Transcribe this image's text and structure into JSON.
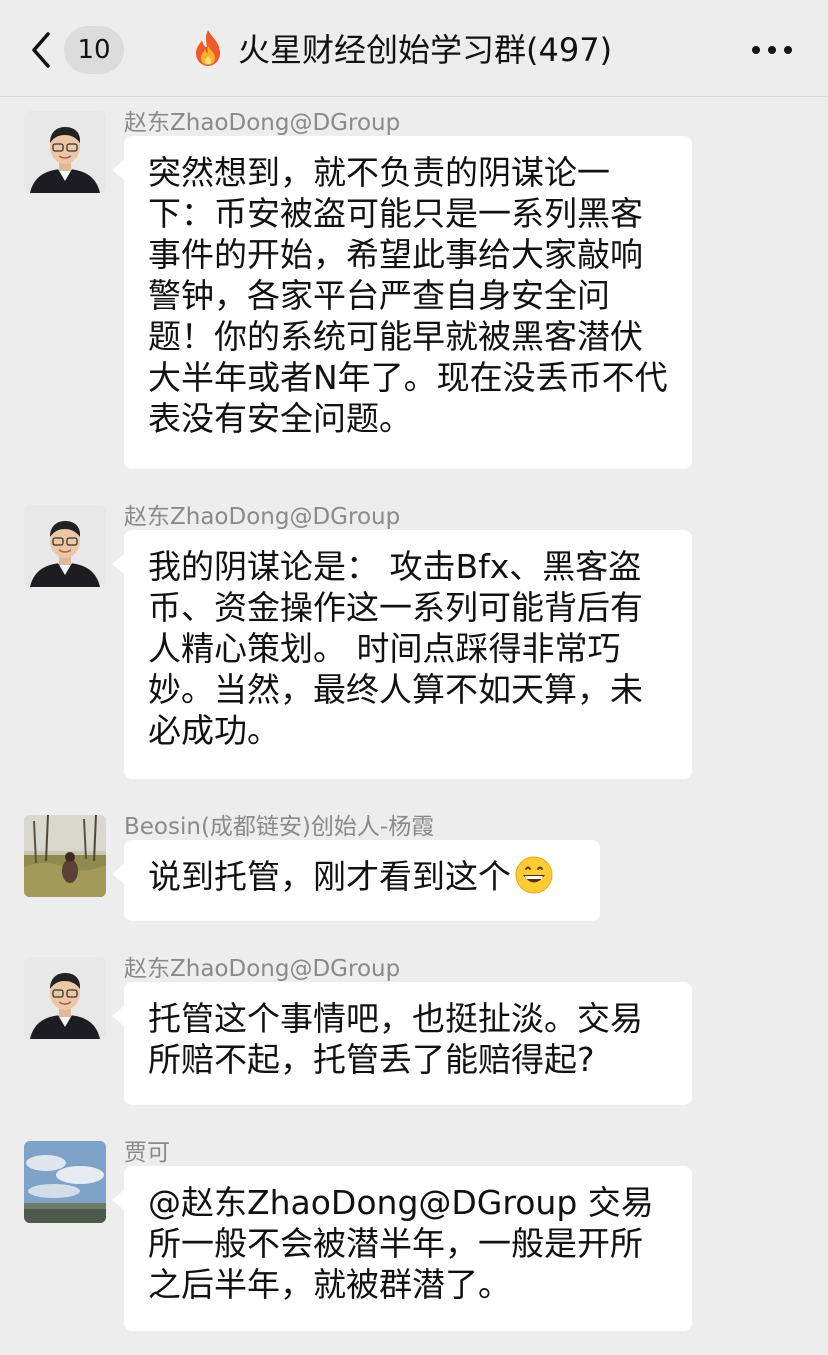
{
  "header": {
    "back_count": "10",
    "title": "火星财经创始学习群(497)"
  },
  "messages": [
    {
      "sender": "赵东ZhaoDong@DGroup",
      "text": "突然想到，就不负责的阴谋论一下：币安被盗可能只是一系列黑客事件的开始，希望此事给大家敲响警钟，各家平台严查自身安全问题！你的系统可能早就被黑客潜伏大半年或者N年了。现在没丢币不代表没有安全问题。"
    },
    {
      "sender": "赵东ZhaoDong@DGroup",
      "text": "我的阴谋论是： 攻击Bfx、黑客盗币、资金操作这一系列可能背后有人精心策划。 时间点踩得非常巧妙。当然，最终人算不如天算，未必成功。"
    },
    {
      "sender": "Beosin(成都链安)创始人-杨霞",
      "text": "说到托管，刚才看到这个"
    },
    {
      "sender": "赵东ZhaoDong@DGroup",
      "text": "托管这个事情吧，也挺扯淡。交易所赔不起，托管丢了能赔得起?"
    },
    {
      "sender": "贾可",
      "text": "@赵东ZhaoDong@DGroup 交易所一般不会被潜半年，一般是开所之后半年，就被群潜了。"
    }
  ]
}
